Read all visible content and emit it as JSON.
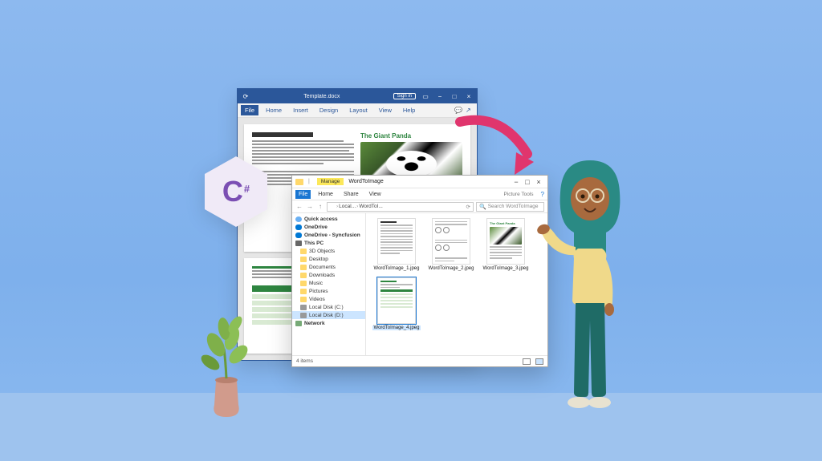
{
  "word": {
    "title": "Template.docx",
    "signin": "Sign in",
    "tabs": [
      "File",
      "Home",
      "Insert",
      "Design",
      "Layout",
      "View",
      "Help"
    ],
    "doc_heading": "The Giant Panda"
  },
  "explorer": {
    "folder_name": "WordToImage",
    "manage_label": "Manage",
    "ribbon": {
      "file": "File",
      "tabs": [
        "Home",
        "Share",
        "View"
      ],
      "subtab": "Picture Tools"
    },
    "breadcrumbs": [
      "Local...",
      "WordToI..."
    ],
    "search_placeholder": "Search WordToImage",
    "tree": {
      "quick_access": "Quick access",
      "onedrive": "OneDrive",
      "onedrive2": "OneDrive - Syncfusion",
      "this_pc": "This PC",
      "items": [
        "3D Objects",
        "Desktop",
        "Documents",
        "Downloads",
        "Music",
        "Pictures",
        "Videos",
        "Local Disk (C:)",
        "Local Disk (D:)"
      ],
      "network": "Network"
    },
    "files": [
      {
        "name": "WordToImage_1.jpeg"
      },
      {
        "name": "WordToImage_2.jpeg"
      },
      {
        "name": "WordToImage_3.jpeg"
      },
      {
        "name": "WordToImage_4.jpeg"
      }
    ],
    "status": "4 items",
    "doc_heading": "The Giant Panda"
  },
  "csharp": {
    "letter": "C",
    "sharp": "#"
  }
}
